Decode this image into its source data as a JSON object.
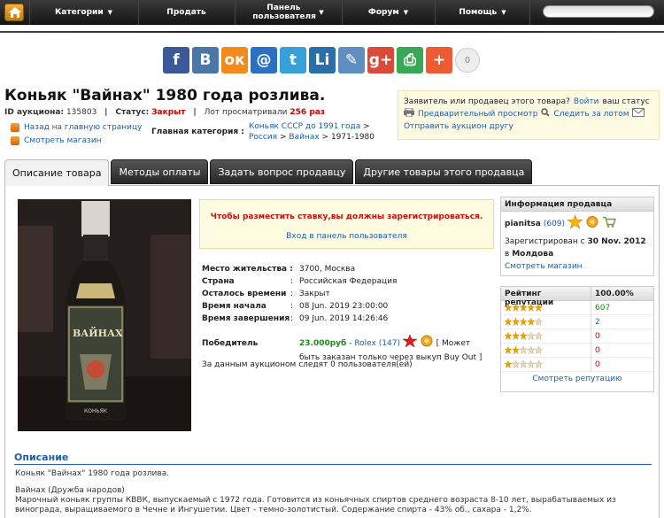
{
  "nav": {
    "items": [
      {
        "label": "Категории",
        "caret": true
      },
      {
        "label": "Продать",
        "caret": false
      },
      {
        "label": "Панель пользователя",
        "caret": true
      },
      {
        "label": "Форум",
        "caret": true
      },
      {
        "label": "Помощь",
        "caret": true
      }
    ]
  },
  "share": {
    "buttons": [
      {
        "name": "facebook",
        "glyph": "f",
        "color": "#3b5998"
      },
      {
        "name": "vkontakte",
        "glyph": "B",
        "color": "#4a76a8"
      },
      {
        "name": "odnoklassniki",
        "glyph": "ок",
        "color": "#f28a1e"
      },
      {
        "name": "mail",
        "glyph": "@",
        "color": "#2a71c1"
      },
      {
        "name": "twitter",
        "glyph": "t",
        "color": "#37a0d8"
      },
      {
        "name": "livejournal",
        "glyph": "Li",
        "color": "#2a6fa8"
      },
      {
        "name": "livejournal-pen",
        "glyph": "✎",
        "color": "#5f8ec0"
      },
      {
        "name": "google-plus",
        "glyph": "g+",
        "color": "#d94a38"
      },
      {
        "name": "print",
        "glyph": "⎙",
        "color": "#3aa756"
      },
      {
        "name": "more",
        "glyph": "+",
        "color": "#ee5b32"
      }
    ],
    "count": "0"
  },
  "auction": {
    "title": "Коньяк \"Вайнах\" 1980 года розлива.",
    "id_label": "ID аукциона:",
    "id_value": "135803",
    "status_label": "Статус:",
    "status_value": "Закрыт",
    "views_label": "Лот просматривали",
    "views_value": "256 раз",
    "back_link": "Назад на главную страницу",
    "shop_link": "Смотреть магазин",
    "main_cat_label": "Главная категория :",
    "cat_path1": "Коньяк СССР до 1991 года",
    "cat_path2": "Россия",
    "cat_path3": "Вайнах",
    "cat_path4": "1971-1980",
    "arrow": ">"
  },
  "seller_box": {
    "line1_text": "Заявитель или продавец этого товара?",
    "line1_link": "Войти",
    "line1_tail": "ваш статус",
    "preview": "Предварительный просмотр",
    "watch": "Следить за лотом",
    "send_friend": "Отправить аукцион другу"
  },
  "tabs": [
    "Описание товара",
    "Методы оплаты",
    "Задать вопрос продавцу",
    "Другие товары этого продавца"
  ],
  "notice": {
    "message": "Чтобы разместить ставку,вы должны зарегистрироваться.",
    "login_link": "Вход в панель пользователя"
  },
  "details": {
    "location_label": "Место жительства",
    "location_value": "3700, Москва",
    "country_label": "Страна",
    "country_value": "Российская Федерация",
    "time_left_label": "Осталось времени",
    "time_left_value": "Закрыт",
    "start_label": "Время начала",
    "start_value": "08 Jun. 2019 23:00:00",
    "end_label": "Время завершения",
    "end_value": "09 Jun. 2019 14:26:46",
    "winner_label": "Победитель",
    "winner_price": "23.000руб",
    "winner_sep": "-",
    "winner_name": "Rolex",
    "winner_rating": "(147)",
    "winner_note_1": "[ Может",
    "winner_note_2": "быть заказан только через выкуп Buy Out ]",
    "watchers": "За данным аукционом следят 0 пользователя(ей)",
    "colon": ":"
  },
  "seller_info": {
    "header": "Информация продавца",
    "name": "pianitsa",
    "rating": "(609)",
    "registered_prefix": "Зарегистрирован с",
    "registered_date": "30 Nov. 2012",
    "registered_in": "в",
    "country": "Молдова",
    "shop_link": "Смотреть магазин"
  },
  "reputation": {
    "header": "Рейтинг репутации",
    "percent": "100.00%",
    "rows": [
      {
        "stars": 5,
        "count": "607",
        "color": "#1d8a1d"
      },
      {
        "stars": 4,
        "count": "2",
        "color": "#1d5fa8"
      },
      {
        "stars": 3,
        "count": "0",
        "color": "#c00"
      },
      {
        "stars": 2,
        "count": "0",
        "color": "#c00"
      },
      {
        "stars": 1,
        "count": "0",
        "color": "#c00"
      }
    ],
    "link": "Смотреть репутацию"
  },
  "description": {
    "heading": "Описание",
    "line1": "Коньяк \"Вайнах\" 1980 года розлива.",
    "line2": "Вайнах (Дружба народов)",
    "line3": "Марочный коньяк группы КВВК, выпускаемый с 1972 года. Готовится из коньячных спиртов среднего возраста 8-10 лет, вырабатываемых из",
    "line4": "винограда, выращиваемого в Чечне и Ингушетии. Цвет - темно-золотистый. Содержание спирта - 43% об., сахара - 1,2%."
  },
  "photo": {
    "label_text": "ВАЙНАХ",
    "label_sub": "КОНЬЯК"
  }
}
